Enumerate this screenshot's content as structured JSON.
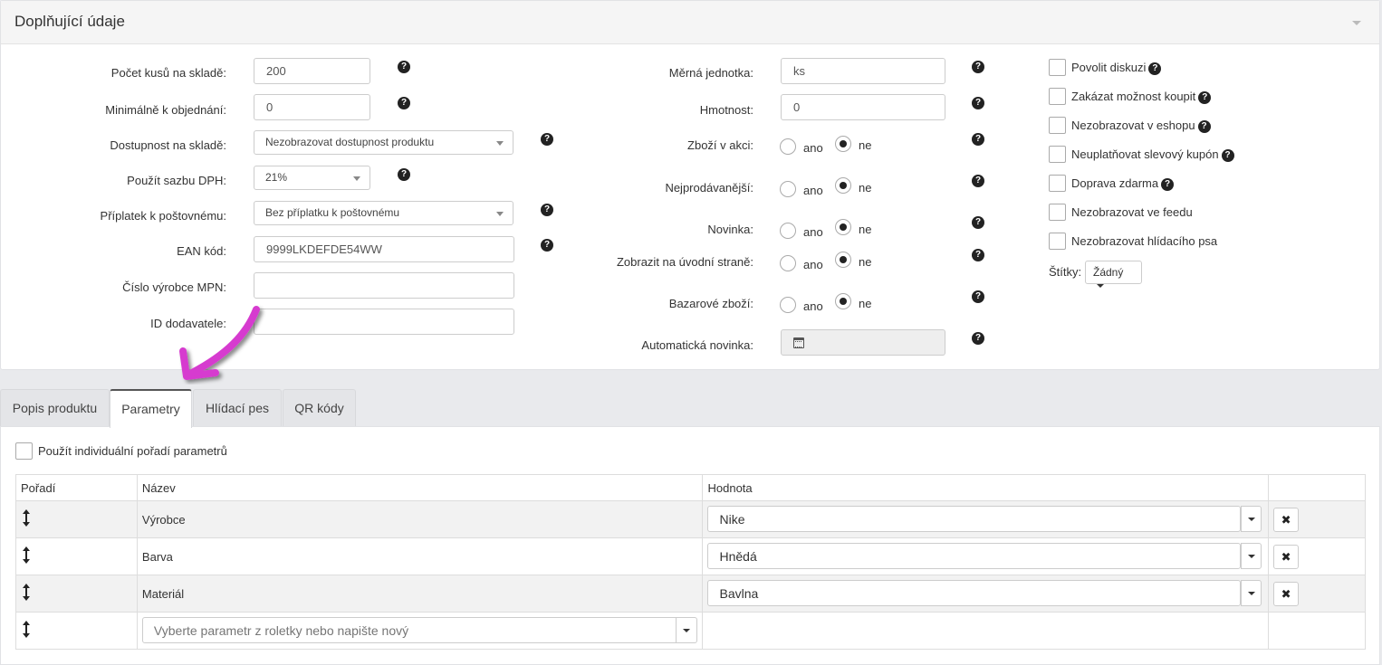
{
  "panel": {
    "title": "Doplňující údaje"
  },
  "left": {
    "stock_label": "Počet kusů na skladě:",
    "stock_value": "200",
    "min_order_label": "Minimálně k objednání:",
    "min_order_value": "0",
    "availability_label": "Dostupnost na skladě:",
    "availability_value": "Nezobrazovat dostupnost produktu",
    "vat_label": "Použít sazbu DPH:",
    "vat_value": "21%",
    "postage_label": "Příplatek k poštovnému:",
    "postage_value": "Bez příplatku k poštovnému",
    "ean_label": "EAN kód:",
    "ean_value": "9999LKDEFDE54WW",
    "mpn_label": "Číslo výrobce MPN:",
    "mpn_value": "",
    "supplier_label": "ID dodavatele:",
    "supplier_value": ""
  },
  "middle": {
    "unit_label": "Měrná jednotka:",
    "unit_value": "ks",
    "weight_label": "Hmotnost:",
    "weight_value": "0",
    "yes": "ano",
    "no": "ne",
    "sale_label": "Zboží v akci:",
    "bestseller_label": "Nejprodávanější:",
    "news_label": "Novinka:",
    "homepage_label": "Zobrazit na úvodní straně:",
    "bazaar_label": "Bazarové zboží:",
    "auto_news_label": "Automatická novinka:"
  },
  "right": {
    "checkboxes": [
      {
        "label": "Povolit diskuzi",
        "help": true
      },
      {
        "label": "Zakázat možnost koupit",
        "help": true
      },
      {
        "label": "Nezobrazovat v eshopu",
        "help": true
      },
      {
        "label": "Neuplatňovat slevový kupón",
        "help": true
      },
      {
        "label": "Doprava zdarma",
        "help": true
      },
      {
        "label": "Nezobrazovat ve feedu",
        "help": false
      },
      {
        "label": "Nezobrazovat hlídacího psa",
        "help": false
      }
    ],
    "tags_label": "Štítky:",
    "tags_value": "Žádný"
  },
  "help_glyph": "?",
  "tabs": [
    {
      "label": "Popis produktu",
      "active": false
    },
    {
      "label": "Parametry",
      "active": true
    },
    {
      "label": "Hlídací pes",
      "active": false
    },
    {
      "label": "QR kódy",
      "active": false
    }
  ],
  "params": {
    "individual_order_label": "Použít individuální pořadí parametrů",
    "headers": {
      "order": "Pořadí",
      "name": "Název",
      "value": "Hodnota"
    },
    "rows": [
      {
        "name": "Výrobce",
        "value": "Nike"
      },
      {
        "name": "Barva",
        "value": "Hnědá"
      },
      {
        "name": "Materiál",
        "value": "Bavlna"
      }
    ],
    "new_placeholder": "Vyberte parametr z roletky nebo napište nový",
    "delete_glyph": "✖"
  },
  "colors": {
    "annotation_arrow": "#d63bcf"
  }
}
